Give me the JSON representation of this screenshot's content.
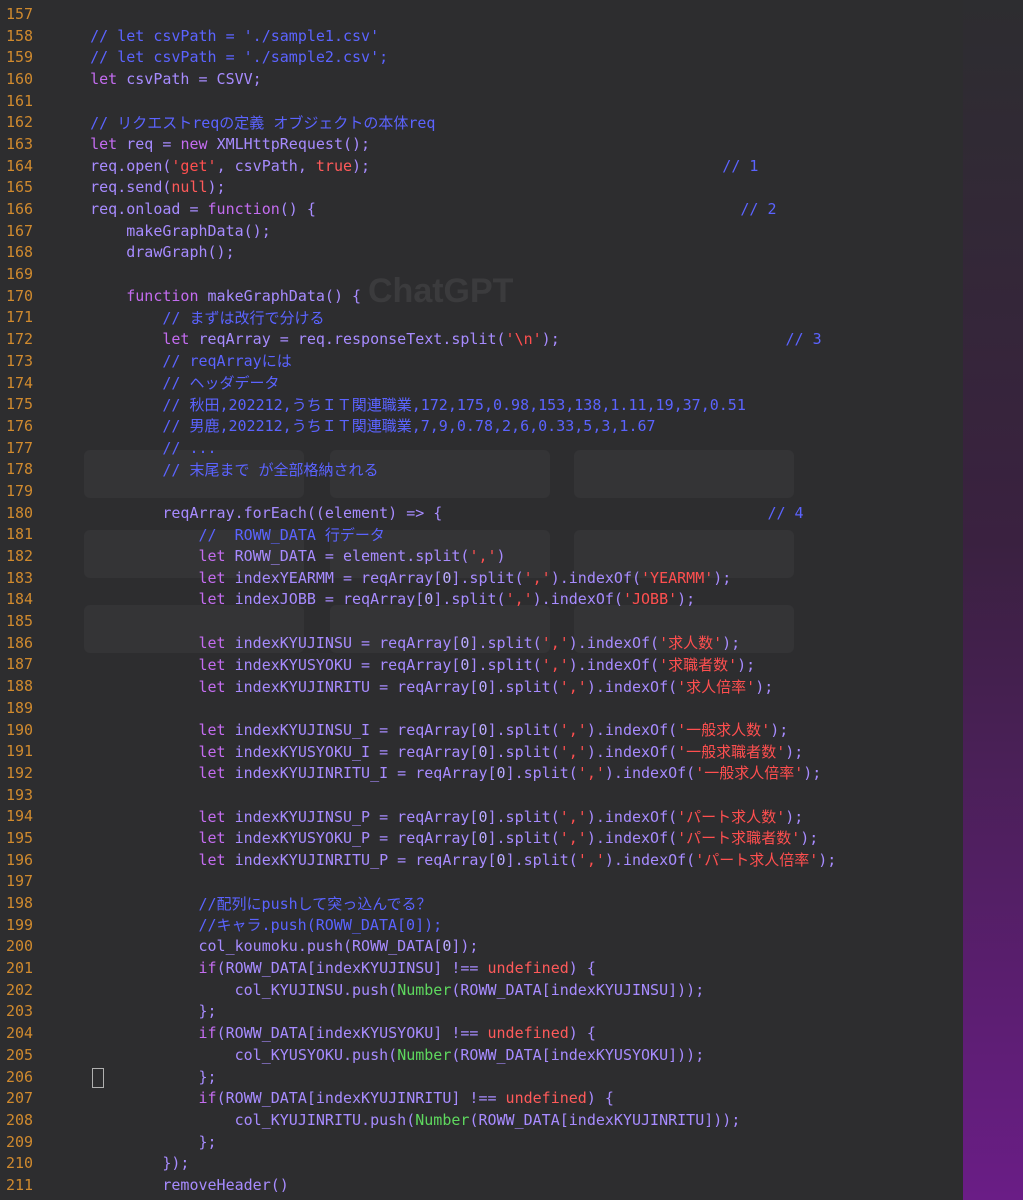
{
  "lines": [
    {
      "n": "157",
      "t": []
    },
    {
      "n": "158",
      "t": [
        [
          "    ",
          ""
        ],
        [
          "// let csvPath = './sample1.csv'",
          "cm"
        ]
      ]
    },
    {
      "n": "159",
      "t": [
        [
          "    ",
          ""
        ],
        [
          "// let csvPath = './sample2.csv';",
          "cm"
        ]
      ]
    },
    {
      "n": "160",
      "t": [
        [
          "    ",
          ""
        ],
        [
          "let ",
          "kw"
        ],
        [
          "csvPath = CSVV;",
          ""
        ]
      ]
    },
    {
      "n": "161",
      "t": []
    },
    {
      "n": "162",
      "t": [
        [
          "    ",
          ""
        ],
        [
          "// リクエストreqの定義 オブジェクトの本体req",
          "cm"
        ]
      ]
    },
    {
      "n": "163",
      "t": [
        [
          "    ",
          ""
        ],
        [
          "let ",
          "kw"
        ],
        [
          "req = ",
          ""
        ],
        [
          "new ",
          "kw"
        ],
        [
          "XMLHttpRequest();",
          ""
        ]
      ]
    },
    {
      "n": "164",
      "t": [
        [
          "    ",
          ""
        ],
        [
          "req.open(",
          ""
        ],
        [
          "'get'",
          "str"
        ],
        [
          ", csvPath, ",
          ""
        ],
        [
          "true",
          "bool"
        ],
        [
          ");                                       ",
          ""
        ],
        [
          "// 1",
          "cm"
        ]
      ]
    },
    {
      "n": "165",
      "t": [
        [
          "    ",
          ""
        ],
        [
          "req.send(",
          ""
        ],
        [
          "null",
          "bool"
        ],
        [
          ");",
          ""
        ]
      ]
    },
    {
      "n": "166",
      "t": [
        [
          "    ",
          ""
        ],
        [
          "req.onload = ",
          ""
        ],
        [
          "function",
          "kw"
        ],
        [
          "() {                                               ",
          ""
        ],
        [
          "// 2",
          "cm"
        ]
      ]
    },
    {
      "n": "167",
      "t": [
        [
          "        ",
          ""
        ],
        [
          "makeGraphData();",
          ""
        ]
      ]
    },
    {
      "n": "168",
      "t": [
        [
          "        ",
          ""
        ],
        [
          "drawGraph();",
          ""
        ]
      ]
    },
    {
      "n": "169",
      "t": []
    },
    {
      "n": "170",
      "t": [
        [
          "        ",
          ""
        ],
        [
          "function ",
          "kw"
        ],
        [
          "makeGraphData() {",
          ""
        ]
      ]
    },
    {
      "n": "171",
      "t": [
        [
          "            ",
          ""
        ],
        [
          "// まずは改行で分ける",
          "cm"
        ]
      ]
    },
    {
      "n": "172",
      "t": [
        [
          "            ",
          ""
        ],
        [
          "let ",
          "kw"
        ],
        [
          "reqArray = req.responseText.split(",
          ""
        ],
        [
          "'\\n'",
          "str"
        ],
        [
          ");                         ",
          ""
        ],
        [
          "// 3",
          "cm"
        ]
      ]
    },
    {
      "n": "173",
      "t": [
        [
          "            ",
          ""
        ],
        [
          "// reqArrayには",
          "cm"
        ]
      ]
    },
    {
      "n": "174",
      "t": [
        [
          "            ",
          ""
        ],
        [
          "// ヘッダデータ",
          "cm"
        ]
      ]
    },
    {
      "n": "175",
      "t": [
        [
          "            ",
          ""
        ],
        [
          "// 秋田,202212,うちＩＴ関連職業,172,175,0.98,153,138,1.11,19,37,0.51",
          "cm"
        ]
      ]
    },
    {
      "n": "176",
      "t": [
        [
          "            ",
          ""
        ],
        [
          "// 男鹿,202212,うちＩＴ関連職業,7,9,0.78,2,6,0.33,5,3,1.67",
          "cm"
        ]
      ]
    },
    {
      "n": "177",
      "t": [
        [
          "            ",
          ""
        ],
        [
          "// ...",
          "cm"
        ]
      ]
    },
    {
      "n": "178",
      "t": [
        [
          "            ",
          ""
        ],
        [
          "// 末尾まで が全部格納される",
          "cm"
        ]
      ]
    },
    {
      "n": "179",
      "t": []
    },
    {
      "n": "180",
      "t": [
        [
          "            ",
          ""
        ],
        [
          "reqArray.forEach((element) => {                                    ",
          ""
        ],
        [
          "// 4",
          "cm"
        ]
      ]
    },
    {
      "n": "181",
      "t": [
        [
          "                ",
          ""
        ],
        [
          "//  ROWW_DATA 行データ",
          "cm"
        ]
      ]
    },
    {
      "n": "182",
      "t": [
        [
          "                ",
          ""
        ],
        [
          "let ",
          "kw"
        ],
        [
          "ROWW_DATA = element.split(",
          ""
        ],
        [
          "','",
          "str"
        ],
        [
          ")",
          ""
        ]
      ]
    },
    {
      "n": "183",
      "t": [
        [
          "                ",
          ""
        ],
        [
          "let ",
          "kw"
        ],
        [
          "indexYEARMM = reqArray[",
          ""
        ],
        [
          "0",
          "num"
        ],
        [
          "].split(",
          ""
        ],
        [
          "','",
          "str"
        ],
        [
          ").indexOf(",
          ""
        ],
        [
          "'YEARMM'",
          "str"
        ],
        [
          ");",
          ""
        ]
      ]
    },
    {
      "n": "184",
      "t": [
        [
          "                ",
          ""
        ],
        [
          "let ",
          "kw"
        ],
        [
          "indexJOBB = reqArray[",
          ""
        ],
        [
          "0",
          "num"
        ],
        [
          "].split(",
          ""
        ],
        [
          "','",
          "str"
        ],
        [
          ").indexOf(",
          ""
        ],
        [
          "'JOBB'",
          "str"
        ],
        [
          ");",
          ""
        ]
      ]
    },
    {
      "n": "185",
      "t": []
    },
    {
      "n": "186",
      "t": [
        [
          "                ",
          ""
        ],
        [
          "let ",
          "kw"
        ],
        [
          "indexKYUJINSU = reqArray[",
          ""
        ],
        [
          "0",
          "num"
        ],
        [
          "].split(",
          ""
        ],
        [
          "','",
          "str"
        ],
        [
          ").indexOf(",
          ""
        ],
        [
          "'求人数'",
          "str"
        ],
        [
          ");",
          ""
        ]
      ]
    },
    {
      "n": "187",
      "t": [
        [
          "                ",
          ""
        ],
        [
          "let ",
          "kw"
        ],
        [
          "indexKYUSYOKU = reqArray[",
          ""
        ],
        [
          "0",
          "num"
        ],
        [
          "].split(",
          ""
        ],
        [
          "','",
          "str"
        ],
        [
          ").indexOf(",
          ""
        ],
        [
          "'求職者数'",
          "str"
        ],
        [
          ");",
          ""
        ]
      ]
    },
    {
      "n": "188",
      "t": [
        [
          "                ",
          ""
        ],
        [
          "let ",
          "kw"
        ],
        [
          "indexKYUJINRITU = reqArray[",
          ""
        ],
        [
          "0",
          "num"
        ],
        [
          "].split(",
          ""
        ],
        [
          "','",
          "str"
        ],
        [
          ").indexOf(",
          ""
        ],
        [
          "'求人倍率'",
          "str"
        ],
        [
          ");",
          ""
        ]
      ]
    },
    {
      "n": "189",
      "t": []
    },
    {
      "n": "190",
      "t": [
        [
          "                ",
          ""
        ],
        [
          "let ",
          "kw"
        ],
        [
          "indexKYUJINSU_I = reqArray[",
          ""
        ],
        [
          "0",
          "num"
        ],
        [
          "].split(",
          ""
        ],
        [
          "','",
          "str"
        ],
        [
          ").indexOf(",
          ""
        ],
        [
          "'一般求人数'",
          "str"
        ],
        [
          ");",
          ""
        ]
      ]
    },
    {
      "n": "191",
      "t": [
        [
          "                ",
          ""
        ],
        [
          "let ",
          "kw"
        ],
        [
          "indexKYUSYOKU_I = reqArray[",
          ""
        ],
        [
          "0",
          "num"
        ],
        [
          "].split(",
          ""
        ],
        [
          "','",
          "str"
        ],
        [
          ").indexOf(",
          ""
        ],
        [
          "'一般求職者数'",
          "str"
        ],
        [
          ");",
          ""
        ]
      ]
    },
    {
      "n": "192",
      "t": [
        [
          "                ",
          ""
        ],
        [
          "let ",
          "kw"
        ],
        [
          "indexKYUJINRITU_I = reqArray[",
          ""
        ],
        [
          "0",
          "num"
        ],
        [
          "].split(",
          ""
        ],
        [
          "','",
          "str"
        ],
        [
          ").indexOf(",
          ""
        ],
        [
          "'一般求人倍率'",
          "str"
        ],
        [
          ");",
          ""
        ]
      ]
    },
    {
      "n": "193",
      "t": []
    },
    {
      "n": "194",
      "t": [
        [
          "                ",
          ""
        ],
        [
          "let ",
          "kw"
        ],
        [
          "indexKYUJINSU_P = reqArray[",
          ""
        ],
        [
          "0",
          "num"
        ],
        [
          "].split(",
          ""
        ],
        [
          "','",
          "str"
        ],
        [
          ").indexOf(",
          ""
        ],
        [
          "'パート求人数'",
          "str"
        ],
        [
          ");",
          ""
        ]
      ]
    },
    {
      "n": "195",
      "t": [
        [
          "                ",
          ""
        ],
        [
          "let ",
          "kw"
        ],
        [
          "indexKYUSYOKU_P = reqArray[",
          ""
        ],
        [
          "0",
          "num"
        ],
        [
          "].split(",
          ""
        ],
        [
          "','",
          "str"
        ],
        [
          ").indexOf(",
          ""
        ],
        [
          "'パート求職者数'",
          "str"
        ],
        [
          ");",
          ""
        ]
      ]
    },
    {
      "n": "196",
      "t": [
        [
          "                ",
          ""
        ],
        [
          "let ",
          "kw"
        ],
        [
          "indexKYUJINRITU_P = reqArray[",
          ""
        ],
        [
          "0",
          "num"
        ],
        [
          "].split(",
          ""
        ],
        [
          "','",
          "str"
        ],
        [
          ").indexOf(",
          ""
        ],
        [
          "'パート求人倍率'",
          "str"
        ],
        [
          ");",
          ""
        ]
      ]
    },
    {
      "n": "197",
      "t": []
    },
    {
      "n": "198",
      "t": [
        [
          "                ",
          ""
        ],
        [
          "//配列にpushして突っ込んでる？",
          "cm"
        ]
      ]
    },
    {
      "n": "199",
      "t": [
        [
          "                ",
          ""
        ],
        [
          "//キャラ.push(ROWW_DATA[0]);",
          "cm"
        ]
      ]
    },
    {
      "n": "200",
      "t": [
        [
          "                ",
          ""
        ],
        [
          "col_koumoku.push(ROWW_DATA[",
          ""
        ],
        [
          "0",
          "num"
        ],
        [
          "]);",
          ""
        ]
      ]
    },
    {
      "n": "201",
      "t": [
        [
          "                ",
          ""
        ],
        [
          "if",
          "kw"
        ],
        [
          "(ROWW_DATA[indexKYUJINSU] !== ",
          ""
        ],
        [
          "undefined",
          "bool"
        ],
        [
          ") {",
          ""
        ]
      ]
    },
    {
      "n": "202",
      "t": [
        [
          "                    ",
          ""
        ],
        [
          "col_KYUJINSU.push(",
          ""
        ],
        [
          "Number",
          "glb"
        ],
        [
          "(ROWW_DATA[indexKYUJINSU]));",
          ""
        ]
      ]
    },
    {
      "n": "203",
      "t": [
        [
          "                ",
          ""
        ],
        [
          "};",
          ""
        ]
      ]
    },
    {
      "n": "204",
      "t": [
        [
          "                ",
          ""
        ],
        [
          "if",
          "kw"
        ],
        [
          "(ROWW_DATA[indexKYUSYOKU] !== ",
          ""
        ],
        [
          "undefined",
          "bool"
        ],
        [
          ") {",
          ""
        ]
      ]
    },
    {
      "n": "205",
      "t": [
        [
          "                    ",
          ""
        ],
        [
          "col_KYUSYOKU.push(",
          ""
        ],
        [
          "Number",
          "glb"
        ],
        [
          "(ROWW_DATA[indexKYUSYOKU]));",
          ""
        ]
      ]
    },
    {
      "n": "206",
      "t": [
        [
          "                ",
          ""
        ],
        [
          "};",
          ""
        ]
      ]
    },
    {
      "n": "207",
      "t": [
        [
          "                ",
          ""
        ],
        [
          "if",
          "kw"
        ],
        [
          "(ROWW_DATA[indexKYUJINRITU] !== ",
          ""
        ],
        [
          "undefined",
          "bool"
        ],
        [
          ") {",
          ""
        ]
      ]
    },
    {
      "n": "208",
      "t": [
        [
          "                    ",
          ""
        ],
        [
          "col_KYUJINRITU.push(",
          ""
        ],
        [
          "Number",
          "glb"
        ],
        [
          "(ROWW_DATA[indexKYUJINRITU]));",
          ""
        ]
      ]
    },
    {
      "n": "209",
      "t": [
        [
          "                ",
          ""
        ],
        [
          "};",
          ""
        ]
      ]
    },
    {
      "n": "210",
      "t": [
        [
          "            ",
          ""
        ],
        [
          "});",
          ""
        ]
      ]
    },
    {
      "n": "211",
      "t": [
        [
          "            ",
          ""
        ],
        [
          "removeHeader()",
          ""
        ]
      ]
    }
  ],
  "ghost": {
    "title": "ChatGPT"
  }
}
